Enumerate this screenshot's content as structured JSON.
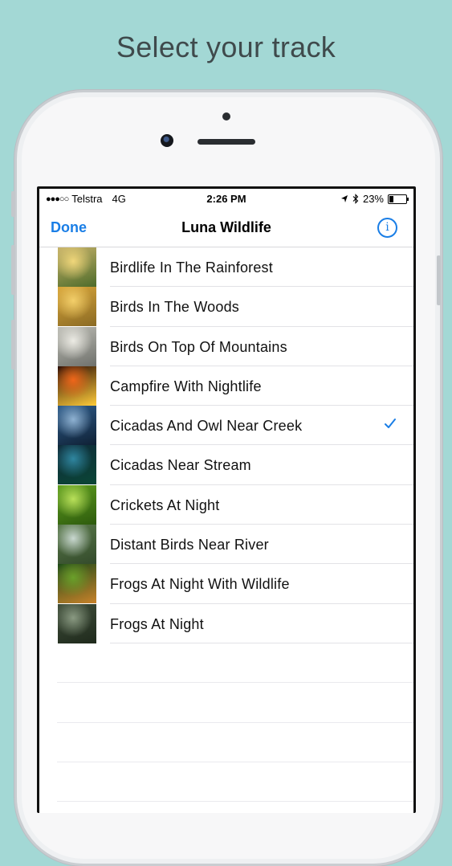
{
  "headline": "Select your track",
  "status_bar": {
    "signal": "●●●○○",
    "carrier": "Telstra",
    "network": "4G",
    "time": "2:26 PM",
    "battery_percent": "23%",
    "battery_level": 0.23,
    "icons": [
      "location-arrow-icon",
      "bluetooth-icon",
      "battery-icon"
    ]
  },
  "nav": {
    "done_label": "Done",
    "title": "Luna Wildlife",
    "info_glyph": "i"
  },
  "tracks": [
    {
      "label": "Birdlife In The Rainforest",
      "thumb": [
        "#c8b36a",
        "#f0d67a",
        "#4d6b2a"
      ],
      "selected": false
    },
    {
      "label": "Birds In The Woods",
      "thumb": [
        "#d9a63a",
        "#f3cf6a",
        "#8a6a24"
      ],
      "selected": false
    },
    {
      "label": "Birds On Top Of Mountains",
      "thumb": [
        "#bdbdb5",
        "#ecebe4",
        "#6f716c"
      ],
      "selected": false
    },
    {
      "label": "Campfire With Nightlife",
      "thumb": [
        "#2a0d05",
        "#f0661a",
        "#ffcc3a"
      ],
      "selected": false
    },
    {
      "label": "Cicadas And Owl Near Creek",
      "thumb": [
        "#2e5d8c",
        "#8fb2d2",
        "#0f2034"
      ],
      "selected": true
    },
    {
      "label": "Cicadas Near Stream",
      "thumb": [
        "#0f2a3a",
        "#2f86a0",
        "#0a4636"
      ],
      "selected": false
    },
    {
      "label": "Crickets At Night",
      "thumb": [
        "#5f9e1f",
        "#b9e05a",
        "#2d5a0d"
      ],
      "selected": false
    },
    {
      "label": "Distant Birds Near River",
      "thumb": [
        "#5a7a4a",
        "#c9d8d0",
        "#334a2b"
      ],
      "selected": false
    },
    {
      "label": "Frogs At Night With Wildlife",
      "thumb": [
        "#1d4a18",
        "#6aa02a",
        "#c9822a"
      ],
      "selected": false
    },
    {
      "label": "Frogs At Night",
      "thumb": [
        "#3f4e3a",
        "#8a9a82",
        "#1f2a1c"
      ],
      "selected": false
    }
  ],
  "colors": {
    "background": "#a3d8d5",
    "accent": "#1a7ee6"
  }
}
